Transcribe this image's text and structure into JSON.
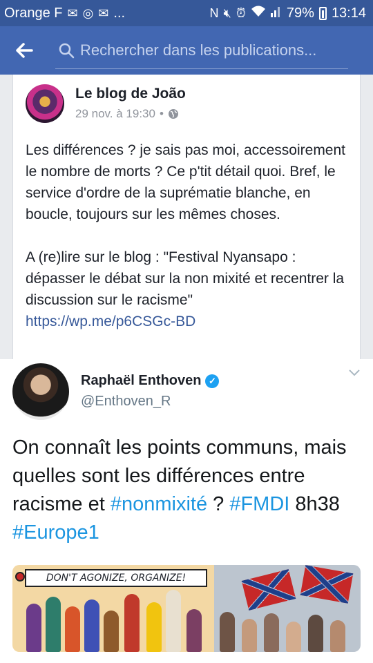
{
  "status_bar": {
    "carrier": "Orange F",
    "notification_icons": [
      "mail-icon",
      "circle-icon",
      "mail-icon"
    ],
    "ellipsis": "...",
    "system_icons": [
      "nfc-icon",
      "mute-icon",
      "alarm-icon",
      "wifi-icon",
      "signal-icon"
    ],
    "battery": "79%",
    "time": "13:14"
  },
  "search": {
    "placeholder": "Rechercher dans les publications..."
  },
  "post": {
    "author": "Le blog de João",
    "date": "29 nov. à 19:30",
    "separator": "•",
    "privacy_icon": "globe-icon",
    "paragraph1": "Les différences ? je sais pas moi, accessoirement le nombre de morts ? Ce p'tit détail quoi. Bref, le service d'ordre de la suprématie blanche, en boucle, toujours sur les mêmes choses.",
    "paragraph2": "A (re)lire sur le blog : \"Festival Nyansapo : dépasser le débat sur la non mixité et recentrer la discussion sur le racisme\"",
    "link": "https://wp.me/p6CSGc-BD"
  },
  "tweet": {
    "name": "Raphaël Enthoven",
    "handle": "@Enthoven_R",
    "text_part1": "On connaît les points communs, mais quelles sont les différences entre racisme et ",
    "hashtag1": "#nonmixité",
    "text_part2": " ? ",
    "hashtag2": "#FMDI",
    "text_part3": " 8h38 ",
    "hashtag3": "#Europe1",
    "image_banner": "DON'T AGONIZE, ORGANIZE!"
  },
  "colors": {
    "facebook_blue": "#4267b2",
    "status_bar": "#365899",
    "twitter_blue": "#1b95e0",
    "link": "#365899"
  }
}
